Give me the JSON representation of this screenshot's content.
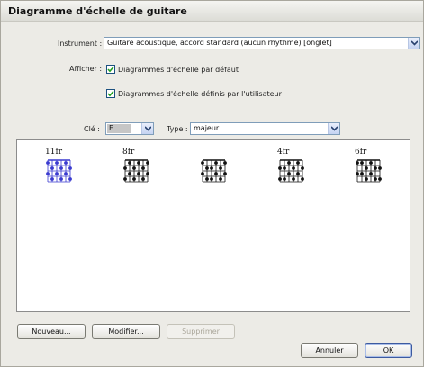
{
  "window": {
    "title": "Diagramme d'échelle de guitare"
  },
  "instrument": {
    "label": "Instrument :",
    "value": "Guitare acoustique, accord standard (aucun rhythme) [onglet]"
  },
  "afficher": {
    "label": "Afficher :",
    "default_diagrams": {
      "label": "Diagrammes d'échelle par défaut",
      "checked": true
    },
    "user_diagrams": {
      "label": "Diagrammes d'échelle définis par l'utilisateur",
      "checked": true
    }
  },
  "key": {
    "label": "Clé :",
    "value": "E"
  },
  "type": {
    "label": "Type :",
    "value": "majeur"
  },
  "diagrams": [
    {
      "fret": "11fr",
      "selected": true
    },
    {
      "fret": "8fr",
      "selected": false
    },
    {
      "fret": "",
      "selected": false
    },
    {
      "fret": "4fr",
      "selected": false
    },
    {
      "fret": "6fr",
      "selected": false
    }
  ],
  "buttons": {
    "new": "Nouveau...",
    "modify": "Modifier...",
    "delete": "Supprimer",
    "cancel": "Annuler",
    "ok": "OK"
  },
  "colors": {
    "accent": "#7f9db9",
    "selection": "#3a3acf"
  }
}
